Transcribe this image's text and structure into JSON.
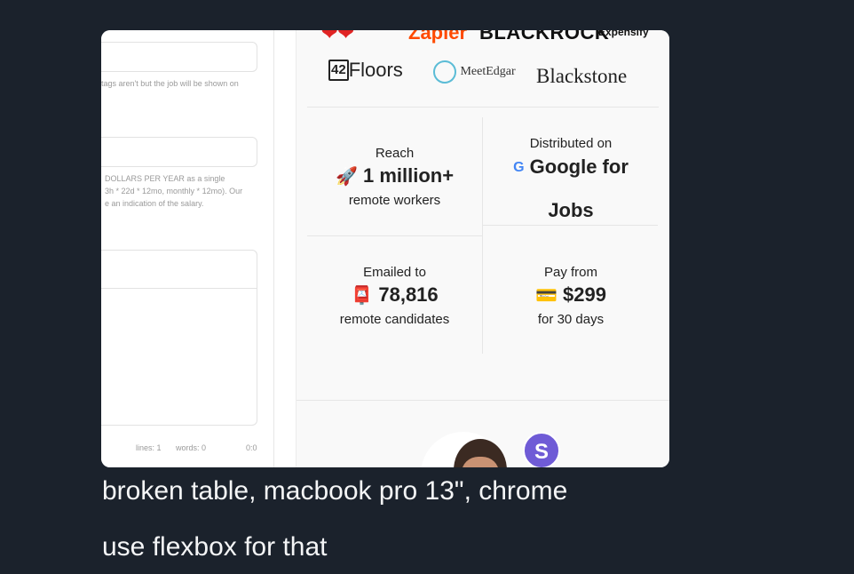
{
  "left_form": {
    "tags_hint": "tags aren't but the job will be shown on",
    "salary_hint_1": "DOLLARS PER YEAR as a single",
    "salary_hint_2": "3h * 22d * 12mo, monthly * 12mo). Our",
    "salary_hint_3": "e an indication of the salary.",
    "lines_label": "lines: 1",
    "words_label": "words: 0",
    "cursor_pos": "0:0"
  },
  "logos": {
    "top_row": [
      "Zapier",
      "BLACKROCK",
      "Expensify"
    ],
    "row2": [
      "42Floors",
      "MeetEdgar",
      "Blackstone"
    ]
  },
  "stats": [
    {
      "label": "Reach",
      "icon": "rocket-icon",
      "glyph": "🚀",
      "value": "1 million+",
      "sub": "remote workers"
    },
    {
      "label": "Distributed on",
      "icon": "google-g-icon",
      "glyph": "G",
      "value": "Google for",
      "value2": "Jobs",
      "sub": ""
    },
    {
      "label": "Emailed to",
      "icon": "mailbox-icon",
      "glyph": "📮",
      "value": "78,816",
      "sub": "remote candidates"
    },
    {
      "label": "Pay from",
      "icon": "credit-card-icon",
      "glyph": "💳",
      "value": "$299",
      "sub": "for 30 days"
    }
  ],
  "avatar_badge": "S",
  "caption": {
    "line1": "broken table, macbook pro 13\", chrome",
    "line2": "use flexbox for that"
  },
  "colors": {
    "page_bg": "#1b222c",
    "zapier": "#ff4a00",
    "badge_bg": "#6f5bd6",
    "caption_text": "#f4f5f6"
  }
}
